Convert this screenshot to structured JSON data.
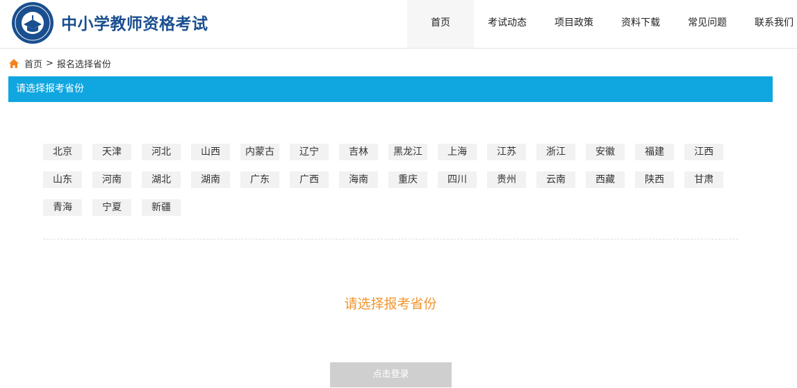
{
  "header": {
    "site_title": "中小学教师资格考试",
    "nav": [
      {
        "label": "首页",
        "active": true
      },
      {
        "label": "考试动态"
      },
      {
        "label": "项目政策"
      },
      {
        "label": "资料下载"
      },
      {
        "label": "常见问题"
      },
      {
        "label": "联系我们"
      }
    ]
  },
  "breadcrumb": {
    "icon": "home-icon",
    "home_label": "首页",
    "separator": ">",
    "current": "报名选择省份"
  },
  "section": {
    "title": "请选择报考省份"
  },
  "provinces": [
    "北京",
    "天津",
    "河北",
    "山西",
    "内蒙古",
    "辽宁",
    "吉林",
    "黑龙江",
    "上海",
    "江苏",
    "浙江",
    "安徽",
    "福建",
    "江西",
    "山东",
    "河南",
    "湖北",
    "湖南",
    "广东",
    "广西",
    "海南",
    "重庆",
    "四川",
    "贵州",
    "云南",
    "西藏",
    "陕西",
    "甘肃",
    "青海",
    "宁夏",
    "新疆"
  ],
  "prompt": "请选择报考省份",
  "login_button": "点击登录",
  "colors": {
    "brand_blue": "#1a4f8f",
    "section_bar": "#10a6e0",
    "prompt_orange": "#f2952c",
    "home_icon_orange": "#f58220",
    "button_disabled": "#cfcfcf"
  }
}
